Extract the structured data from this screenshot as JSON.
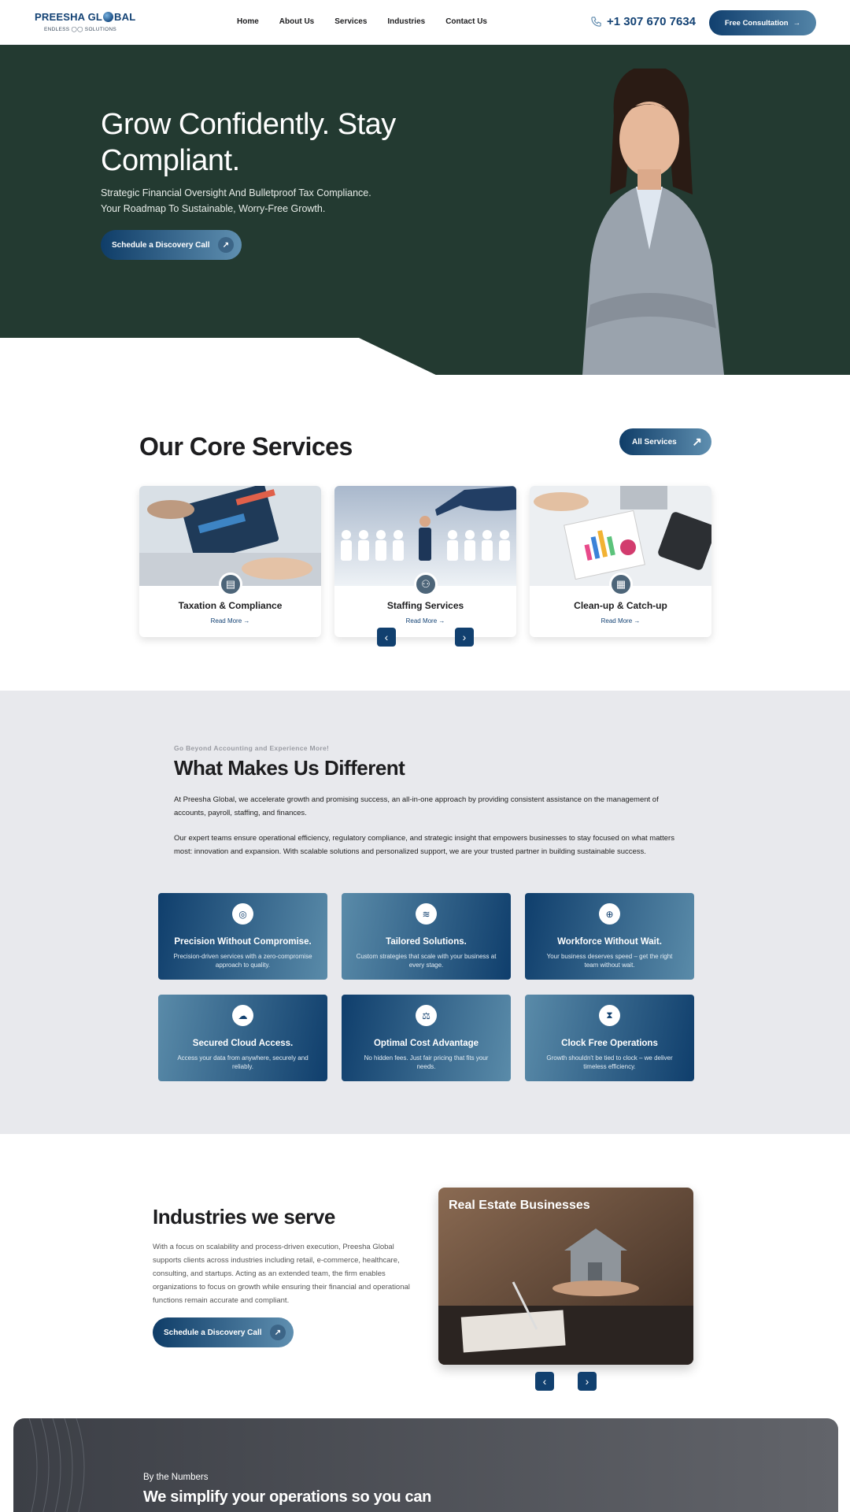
{
  "header": {
    "logo_main_a": "PREESHA GL",
    "logo_main_b": "BAL",
    "logo_sub": "ENDLESS ◯◯ SOLUTIONS",
    "nav": [
      "Home",
      "About Us",
      "Services",
      "Industries",
      "Contact Us"
    ],
    "phone": "+1 307 670 7634",
    "cta": "Free Consultation"
  },
  "hero": {
    "title": "Grow Confidently. Stay Compliant.",
    "subtitle_line1": "Strategic Financial Oversight And Bulletproof Tax Compliance.",
    "subtitle_line2": "Your Roadmap To Sustainable, Worry-Free Growth.",
    "cta": "Schedule a Discovery Call"
  },
  "services": {
    "title": "Our Core Services",
    "all_button": "All Services",
    "cards": [
      {
        "title": "Taxation & Compliance",
        "link": "Read More →"
      },
      {
        "title": "Staffing Services",
        "link": "Read More →"
      },
      {
        "title": "Clean-up & Catch-up",
        "link": "Read More →"
      }
    ]
  },
  "different": {
    "eyebrow": "Go Beyond Accounting and Experience More!",
    "title": "What Makes Us Different",
    "p1": "At Preesha Global, we accelerate growth and promising success, an all-in-one approach by providing consistent assistance on the management of accounts, payroll, staffing, and finances.",
    "p2": "Our expert teams ensure operational efficiency, regulatory compliance, and strategic insight that empowers businesses to stay focused on what matters most: innovation and expansion. With scalable solutions and personalized support, we are your trusted partner in building sustainable success.",
    "features": [
      {
        "title": "Precision Without Compromise.",
        "desc": "Precision-driven services with a zero-compromise approach to quality.",
        "icon": "target-icon"
      },
      {
        "title": "Tailored Solutions.",
        "desc": "Custom strategies that scale with your business at every stage.",
        "icon": "layers-icon"
      },
      {
        "title": "Workforce Without Wait.",
        "desc": "Your business deserves speed – get the right team without wait.",
        "icon": "globe-icon"
      },
      {
        "title": "Secured Cloud Access.",
        "desc": "Access your data from anywhere, securely and reliably.",
        "icon": "cloud-icon"
      },
      {
        "title": "Optimal Cost Advantage",
        "desc": "No hidden fees. Just fair pricing that fits your needs.",
        "icon": "scale-icon"
      },
      {
        "title": "Clock Free Operations",
        "desc": "Growth shouldn't be tied to clock – we deliver timeless efficiency.",
        "icon": "hourglass-icon"
      }
    ]
  },
  "industries": {
    "title": "Industries we serve",
    "text": "With a focus on scalability and process-driven execution, Preesha Global supports clients across industries including retail, e-commerce, healthcare, consulting, and startups. Acting as an extended team, the firm enables organizations to focus on growth while ensuring their financial and operational functions remain accurate and compliant.",
    "cta": "Schedule a Discovery Call",
    "slide_label": "Real Estate Businesses"
  },
  "numbers": {
    "eyebrow": "By the Numbers",
    "title": "We simplify your operations so you can"
  }
}
